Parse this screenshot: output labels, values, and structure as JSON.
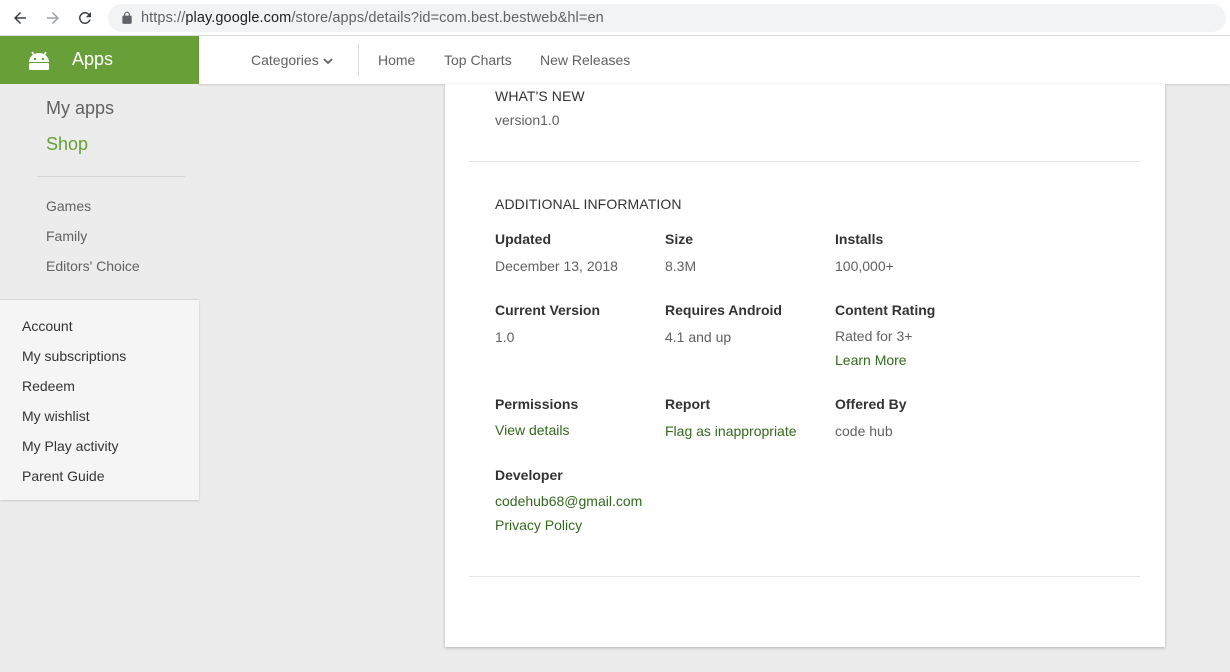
{
  "browser": {
    "url_prefix": "https://",
    "url_host": "play.google.com",
    "url_path": "/store/apps/details?id=com.best.bestweb&hl=en"
  },
  "header": {
    "apps_title": "Apps",
    "nav": {
      "categories": "Categories",
      "home": "Home",
      "top_charts": "Top Charts",
      "new_releases": "New Releases"
    }
  },
  "sidebar": {
    "my_apps": "My apps",
    "shop": "Shop",
    "categories": [
      "Games",
      "Family",
      "Editors' Choice"
    ],
    "links": [
      "Account",
      "My subscriptions",
      "Redeem",
      "My wishlist",
      "My Play activity",
      "Parent Guide"
    ]
  },
  "whats_new": {
    "title": "WHAT'S NEW",
    "text": "version1.0"
  },
  "additional_info": {
    "title": "ADDITIONAL INFORMATION",
    "updated": {
      "label": "Updated",
      "value": "December 13, 2018"
    },
    "size": {
      "label": "Size",
      "value": "8.3M"
    },
    "installs": {
      "label": "Installs",
      "value": "100,000+"
    },
    "current_version": {
      "label": "Current Version",
      "value": "1.0"
    },
    "requires_android": {
      "label": "Requires Android",
      "value": "4.1 and up"
    },
    "content_rating": {
      "label": "Content Rating",
      "value": "Rated for 3+",
      "link": "Learn More"
    },
    "permissions": {
      "label": "Permissions",
      "link": "View details"
    },
    "report": {
      "label": "Report",
      "link": "Flag as inappropriate"
    },
    "offered_by": {
      "label": "Offered By",
      "value": "code hub"
    },
    "developer": {
      "label": "Developer",
      "email": "codehub68@gmail.com",
      "privacy": "Privacy Policy"
    }
  },
  "colors": {
    "brand_green": "#689f38",
    "link_green": "#33691e"
  }
}
